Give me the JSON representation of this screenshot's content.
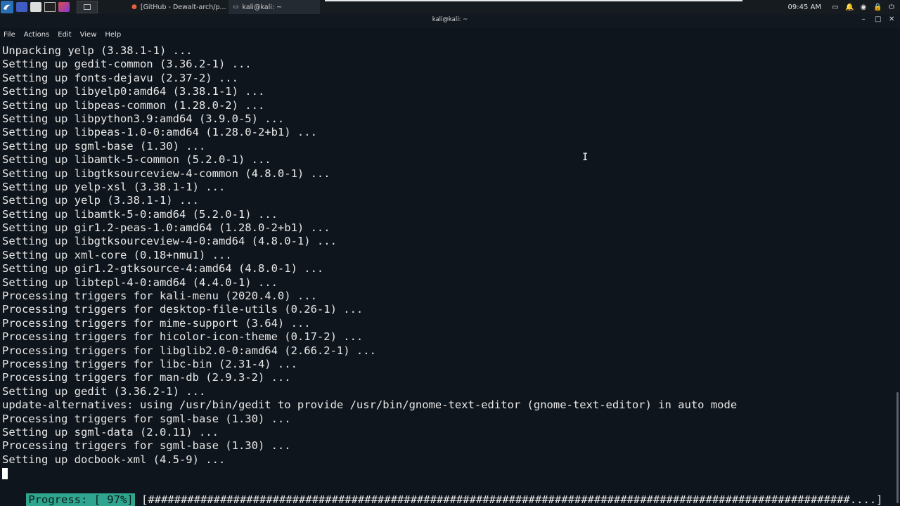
{
  "panel": {
    "tasks": [
      {
        "icon": "firefox-icon",
        "label": "[GitHub - Dewalt-arch/p..."
      },
      {
        "icon": "terminal-icon",
        "label": "kali@kali: ~"
      }
    ],
    "clock": "09:45 AM"
  },
  "window": {
    "title": "kali@kali: ~"
  },
  "menu": [
    "File",
    "Actions",
    "Edit",
    "View",
    "Help"
  ],
  "terminal": {
    "lines": [
      "Unpacking yelp (3.38.1-1) ...",
      "Setting up gedit-common (3.36.2-1) ...",
      "Setting up fonts-dejavu (2.37-2) ...",
      "Setting up libyelp0:amd64 (3.38.1-1) ...",
      "Setting up libpeas-common (1.28.0-2) ...",
      "Setting up libpython3.9:amd64 (3.9.0-5) ...",
      "Setting up libpeas-1.0-0:amd64 (1.28.0-2+b1) ...",
      "Setting up sgml-base (1.30) ...",
      "Setting up libamtk-5-common (5.2.0-1) ...",
      "Setting up libgtksourceview-4-common (4.8.0-1) ...",
      "Setting up yelp-xsl (3.38.1-1) ...",
      "Setting up yelp (3.38.1-1) ...",
      "Setting up libamtk-5-0:amd64 (5.2.0-1) ...",
      "Setting up gir1.2-peas-1.0:amd64 (1.28.0-2+b1) ...",
      "Setting up libgtksourceview-4-0:amd64 (4.8.0-1) ...",
      "Setting up xml-core (0.18+nmu1) ...",
      "Setting up gir1.2-gtksource-4:amd64 (4.8.0-1) ...",
      "Setting up libtepl-4-0:amd64 (4.4.0-1) ...",
      "Processing triggers for kali-menu (2020.4.0) ...",
      "Processing triggers for desktop-file-utils (0.26-1) ...",
      "Processing triggers for mime-support (3.64) ...",
      "Processing triggers for hicolor-icon-theme (0.17-2) ...",
      "Processing triggers for libglib2.0-0:amd64 (2.66.2-1) ...",
      "Processing triggers for libc-bin (2.31-4) ...",
      "Processing triggers for man-db (2.9.3-2) ...",
      "Setting up gedit (3.36.2-1) ...",
      "update-alternatives: using /usr/bin/gedit to provide /usr/bin/gnome-text-editor (gnome-text-editor) in auto mode",
      "Processing triggers for sgml-base (1.30) ...",
      "Setting up sgml-data (2.0.11) ...",
      "Processing triggers for sgml-base (1.30) ...",
      "Setting up docbook-xml (4.5-9) ..."
    ],
    "progress_label": "Progress: [ 97%]",
    "progress_bar": "[###########################################################################################################....]",
    "progress_percent": 97
  }
}
